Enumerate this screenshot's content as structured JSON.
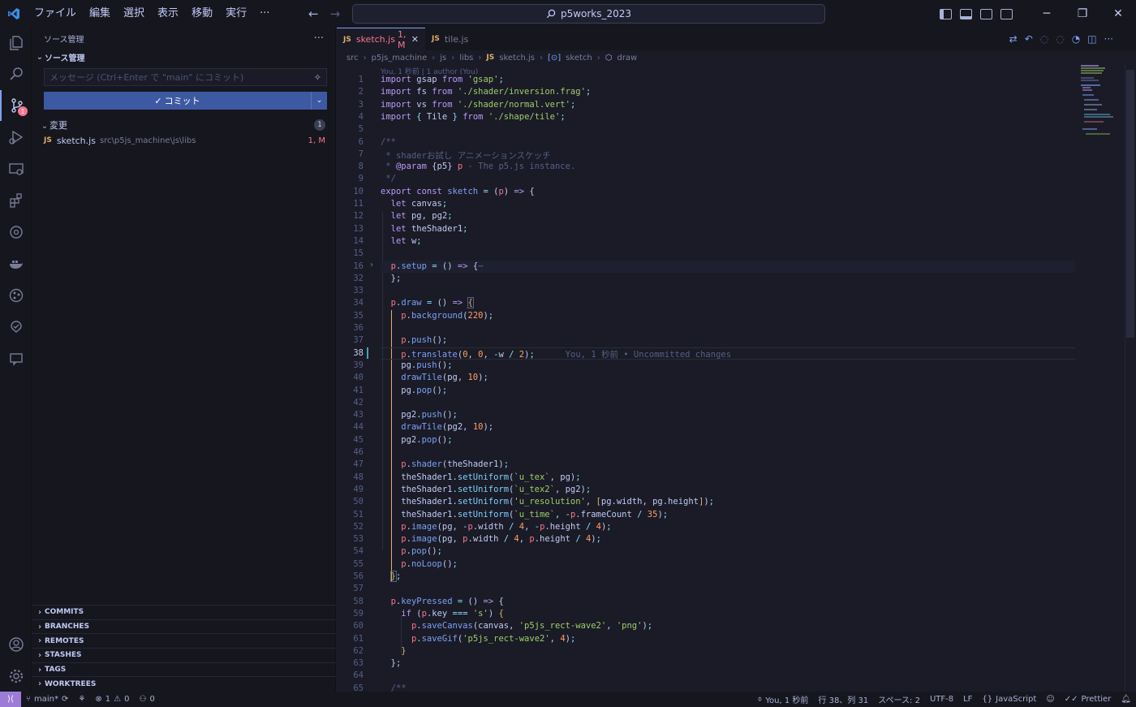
{
  "titlebar": {
    "menu": [
      "ファイル",
      "編集",
      "選択",
      "表示",
      "移動",
      "実行",
      "···"
    ],
    "search": "p5works_2023"
  },
  "activity": {
    "scm_badge": "1"
  },
  "sidebar": {
    "header": "ソース管理",
    "section_title": "ソース管理",
    "message_placeholder": "メッセージ (Ctrl+Enter で \"main\" にコミット)",
    "commit_label": "コミット",
    "changes_label": "変更",
    "changes_count": "1",
    "file": {
      "name": "sketch.js",
      "path": "src\\p5js_machine\\js\\libs",
      "status": "1, M"
    },
    "bottom_sections": [
      "COMMITS",
      "BRANCHES",
      "REMOTES",
      "STASHES",
      "TAGS",
      "WORKTREES"
    ]
  },
  "editor": {
    "tabs": [
      {
        "name": "sketch.js",
        "status": "1, M"
      },
      {
        "name": "tile.js",
        "status": ""
      }
    ],
    "breadcrumbs": [
      "src",
      "p5js_machine",
      "js",
      "libs",
      "sketch.js",
      "sketch",
      "draw"
    ],
    "blame_header": "You, 1 秒前 | 1 author (You)",
    "inline_blame": "You, 1 秒前 • Uncommitted changes",
    "line_numbers": [
      "1",
      "2",
      "3",
      "4",
      "5",
      "6",
      "7",
      "8",
      "9",
      "10",
      "11",
      "12",
      "13",
      "14",
      "15",
      "16",
      "32",
      "33",
      "34",
      "35",
      "36",
      "37",
      "38",
      "39",
      "40",
      "41",
      "42",
      "43",
      "44",
      "45",
      "46",
      "47",
      "48",
      "49",
      "50",
      "51",
      "52",
      "53",
      "54",
      "55",
      "56",
      "57",
      "58",
      "59",
      "60",
      "61",
      "62",
      "63",
      "64",
      "65"
    ],
    "current_line": "38"
  },
  "status": {
    "branch": "main*",
    "errors": "1",
    "warnings": "0",
    "ports": "0",
    "blame": "You, 1 秒前",
    "position": "行 38、列 31",
    "spaces": "スペース: 2",
    "encoding": "UTF-8",
    "eol": "LF",
    "language": "JavaScript",
    "formatter": "Prettier"
  },
  "colors": {
    "accent": "#7aa2f7",
    "commit_button": "#3d59a1",
    "modified": "#f7768e",
    "background": "#1a1b26"
  }
}
